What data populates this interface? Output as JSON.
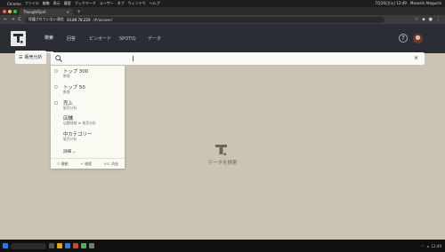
{
  "os": {
    "menubar": {
      "apple": "",
      "items": [
        "Chrome",
        "ファイル",
        "編集",
        "表示",
        "履歴",
        "ブックマーク",
        "ユーザー",
        "タブ",
        "ウィンドウ",
        "ヘルプ"
      ],
      "clock": "7月26日(火) 12:49",
      "user": "Masashi Ataguchi"
    },
    "taskbar": {
      "time": "12:49"
    }
  },
  "browser": {
    "tab_title": "ThoughtSpot",
    "tab_close": "×",
    "new_tab": "+",
    "security_label": "保護されていない通信",
    "host": "10.89.78.220",
    "path": "/#/answer/",
    "nav_back": "←",
    "nav_forward": "→",
    "reload": "C"
  },
  "app": {
    "nav": [
      {
        "label": "検索",
        "active": true
      },
      {
        "label": "回答",
        "active": false
      },
      {
        "label": "ピンボード",
        "active": false
      },
      {
        "label": "SPOTIQ",
        "active": false
      },
      {
        "label": "データ",
        "active": false
      }
    ],
    "help": "?",
    "topic_button": "販売分析",
    "search": {
      "value": "",
      "clear": "×"
    },
    "suggestions": [
      {
        "title": "トップ 300",
        "subtitle": "数値"
      },
      {
        "title": "トップ 50",
        "subtitle": "数値"
      },
      {
        "title": "売上",
        "subtitle": "販売分析"
      },
      {
        "title": "店舗",
        "subtitle": "店舗地域 ≫ 販売分析"
      },
      {
        "title": "中カテゴリー",
        "subtitle": "販売分析"
      }
    ],
    "more": "詳細 ⌄",
    "footer": {
      "move_key": "⇕",
      "move": "移動",
      "search_key": "↵",
      "search": "検索",
      "close_key": "esc",
      "close": "消去"
    },
    "empty_state": "データを検索"
  },
  "colors": {
    "nav_bg": "#2a2d34",
    "canvas_bg": "#cbc4b3",
    "dropdown_bg": "#fbfaf2"
  }
}
